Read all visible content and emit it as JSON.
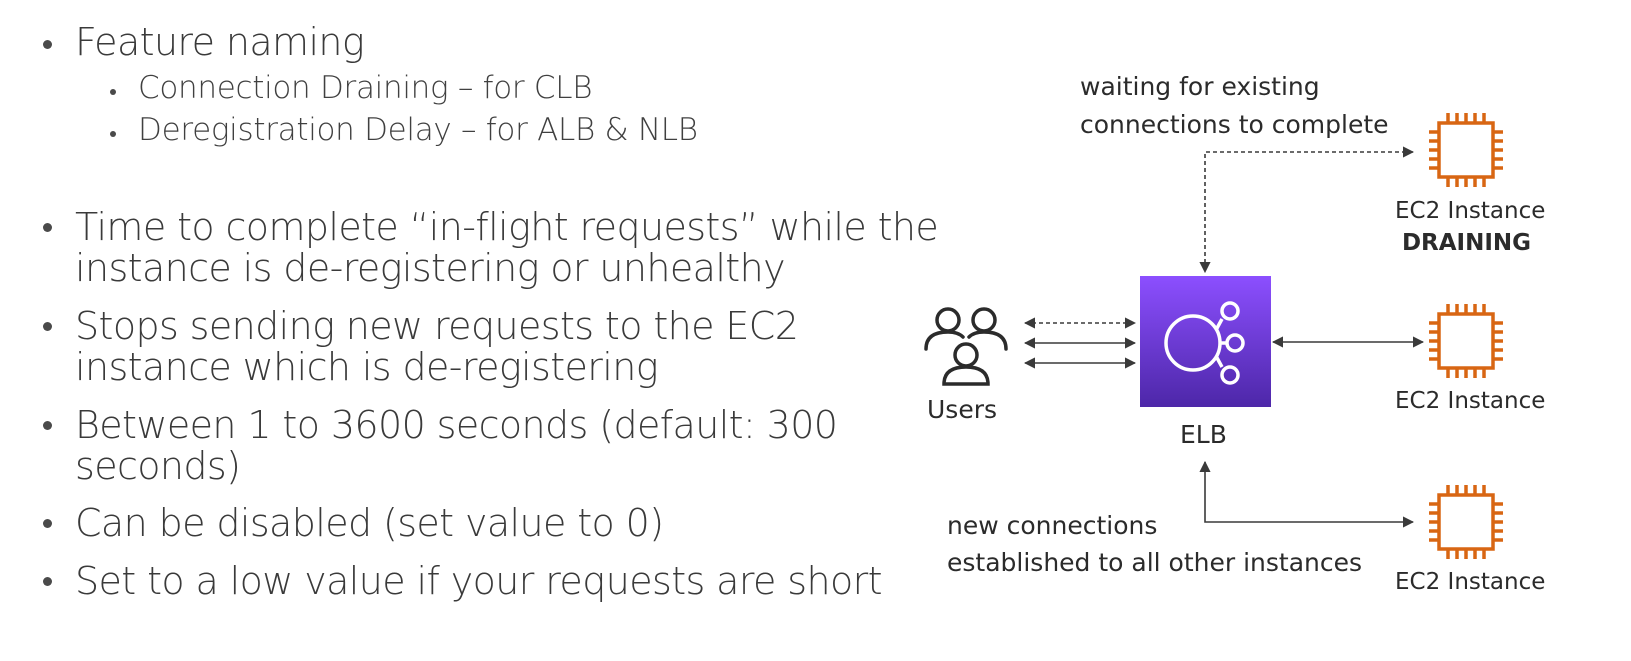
{
  "bullets": {
    "feature_naming": {
      "label": "Feature naming",
      "items": [
        "Connection Draining – for CLB",
        "Deregistration Delay – for ALB & NLB"
      ]
    },
    "points": [
      [
        "Time to complete “in-flight requests” while the",
        "instance is de-registering or unhealthy"
      ],
      [
        "Stops sending new requests to the EC2",
        "instance which is de-registering"
      ],
      [
        "Between 1 to 3600 seconds (default: 300",
        "seconds)"
      ],
      [
        "Can be disabled (set value to 0)"
      ],
      [
        "Set to a low value if your requests are short"
      ]
    ]
  },
  "diagram": {
    "waiting_label": {
      "prefix": "waiting for ",
      "emphasis": "existing",
      "line2": "connections to complete"
    },
    "new_conn_label": {
      "line1": "new connections",
      "line2": "established to all other instances"
    },
    "users_label": "Users",
    "elb_label": "ELB",
    "instances": [
      {
        "label": "EC2 Instance",
        "status": "DRAINING"
      },
      {
        "label": "EC2 Instance",
        "status": ""
      },
      {
        "label": "EC2 Instance",
        "status": ""
      }
    ],
    "colors": {
      "elb_top": "#8c4fff",
      "elb_bottom": "#4d27a8",
      "ec2": "#d86613",
      "text": "#2b2b2b",
      "arrow": "#3a3a3a"
    }
  }
}
